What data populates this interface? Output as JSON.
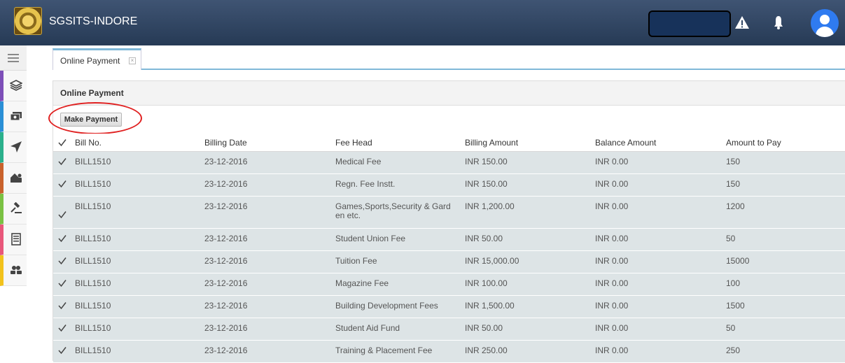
{
  "app": {
    "title": "SGSITS-INDORE"
  },
  "header_icons": [
    "warning-icon",
    "bell-icon",
    "user-avatar-icon"
  ],
  "sidebar": {
    "items": [
      {
        "icon": "layers-icon",
        "color": "#7d4fb8"
      },
      {
        "icon": "money-icon",
        "color": "#2a8fd6"
      },
      {
        "icon": "navigation-arrow-icon",
        "color": "#2bb08c"
      },
      {
        "icon": "users-home-icon",
        "color": "#c9622c"
      },
      {
        "icon": "gavel-icon",
        "color": "#7ac143"
      },
      {
        "icon": "document-list-icon",
        "color": "#e8577a"
      },
      {
        "icon": "group-icon",
        "color": "#f2c21b"
      }
    ]
  },
  "tabs": [
    {
      "label": "Online Payment"
    }
  ],
  "panel": {
    "title": "Online Payment",
    "make_payment_label": "Make Payment"
  },
  "table": {
    "columns": [
      "Bill No.",
      "Billing Date",
      "Fee Head",
      "Billing Amount",
      "Balance Amount",
      "Amount to Pay"
    ],
    "rows": [
      {
        "bill": "BILL1510",
        "date": "23-12-2016",
        "fee_head": "Medical Fee",
        "billing_amount": "INR 150.00",
        "balance": "INR 0.00",
        "pay": "150"
      },
      {
        "bill": "BILL1510",
        "date": "23-12-2016",
        "fee_head": "Regn. Fee Instt.",
        "billing_amount": "INR 150.00",
        "balance": "INR 0.00",
        "pay": "150"
      },
      {
        "bill": "BILL1510",
        "date": "23-12-2016",
        "fee_head": "Games,Sports,Security & Gard en etc.",
        "billing_amount": "INR 1,200.00",
        "balance": "INR 0.00",
        "pay": "1200"
      },
      {
        "bill": "BILL1510",
        "date": "23-12-2016",
        "fee_head": "Student Union Fee",
        "billing_amount": "INR 50.00",
        "balance": "INR 0.00",
        "pay": "50"
      },
      {
        "bill": "BILL1510",
        "date": "23-12-2016",
        "fee_head": "Tuition Fee",
        "billing_amount": "INR 15,000.00",
        "balance": "INR 0.00",
        "pay": "15000"
      },
      {
        "bill": "BILL1510",
        "date": "23-12-2016",
        "fee_head": "Magazine Fee",
        "billing_amount": "INR 100.00",
        "balance": "INR 0.00",
        "pay": "100"
      },
      {
        "bill": "BILL1510",
        "date": "23-12-2016",
        "fee_head": "Building Development Fees",
        "billing_amount": "INR 1,500.00",
        "balance": "INR 0.00",
        "pay": "1500"
      },
      {
        "bill": "BILL1510",
        "date": "23-12-2016",
        "fee_head": "Student Aid Fund",
        "billing_amount": "INR 50.00",
        "balance": "INR 0.00",
        "pay": "50"
      },
      {
        "bill": "BILL1510",
        "date": "23-12-2016",
        "fee_head": "Training & Placement Fee",
        "billing_amount": "INR 250.00",
        "balance": "INR 0.00",
        "pay": "250"
      }
    ]
  }
}
